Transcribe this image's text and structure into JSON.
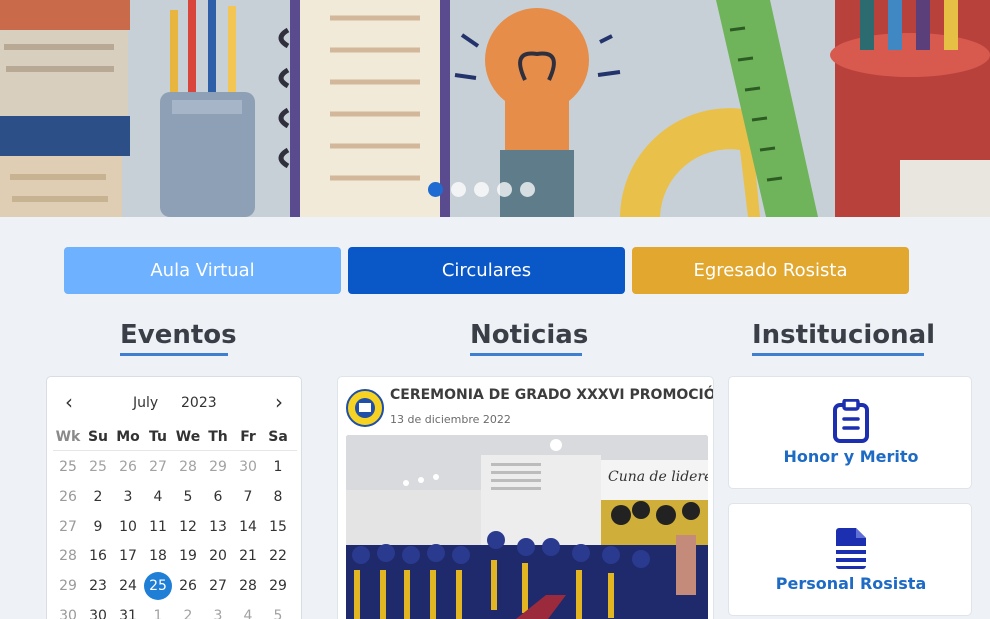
{
  "hero": {
    "slide_count": 5,
    "active_slide": 1
  },
  "quick_links": {
    "aula_virtual": "Aula Virtual",
    "circulares": "Circulares",
    "egresado": "Egresado Rosista",
    "colors": {
      "aula_virtual": "#6db1ff",
      "circulares": "#0a57c8",
      "egresado": "#e1a72f"
    }
  },
  "sections": {
    "eventos": "Eventos",
    "noticias": "Noticias",
    "institucional": "Institucional"
  },
  "calendar": {
    "prev_icon": "chevron-left-icon",
    "next_icon": "chevron-right-icon",
    "month": "July",
    "year": "2023",
    "headers": [
      "Wk",
      "Su",
      "Mo",
      "Tu",
      "We",
      "Th",
      "Fr",
      "Sa"
    ],
    "weeks": [
      {
        "wk": "25",
        "days": [
          "25",
          "26",
          "27",
          "28",
          "29",
          "30",
          "1"
        ]
      },
      {
        "wk": "26",
        "days": [
          "2",
          "3",
          "4",
          "5",
          "6",
          "7",
          "8"
        ]
      },
      {
        "wk": "27",
        "days": [
          "9",
          "10",
          "11",
          "12",
          "13",
          "14",
          "15"
        ]
      },
      {
        "wk": "28",
        "days": [
          "16",
          "17",
          "18",
          "19",
          "20",
          "21",
          "22"
        ]
      },
      {
        "wk": "29",
        "days": [
          "23",
          "24",
          "25",
          "26",
          "27",
          "28",
          "29"
        ]
      },
      {
        "wk": "30",
        "days": [
          "30",
          "31",
          "1",
          "2",
          "3",
          "4",
          "5"
        ]
      }
    ],
    "today": "25",
    "accent": "#1f7fd6"
  },
  "news": {
    "title": "CEREMONIA DE GRADO XXXVI PROMOCIÓN",
    "date": "13 de diciembre 2022",
    "banner_text": "Cuna de lideres"
  },
  "institucional": {
    "honor": "Honor y Merito",
    "personal": "Personal Rosista",
    "honor_icon": "clipboard-icon",
    "personal_icon": "document-icon",
    "accent": "#1e6bc6"
  }
}
